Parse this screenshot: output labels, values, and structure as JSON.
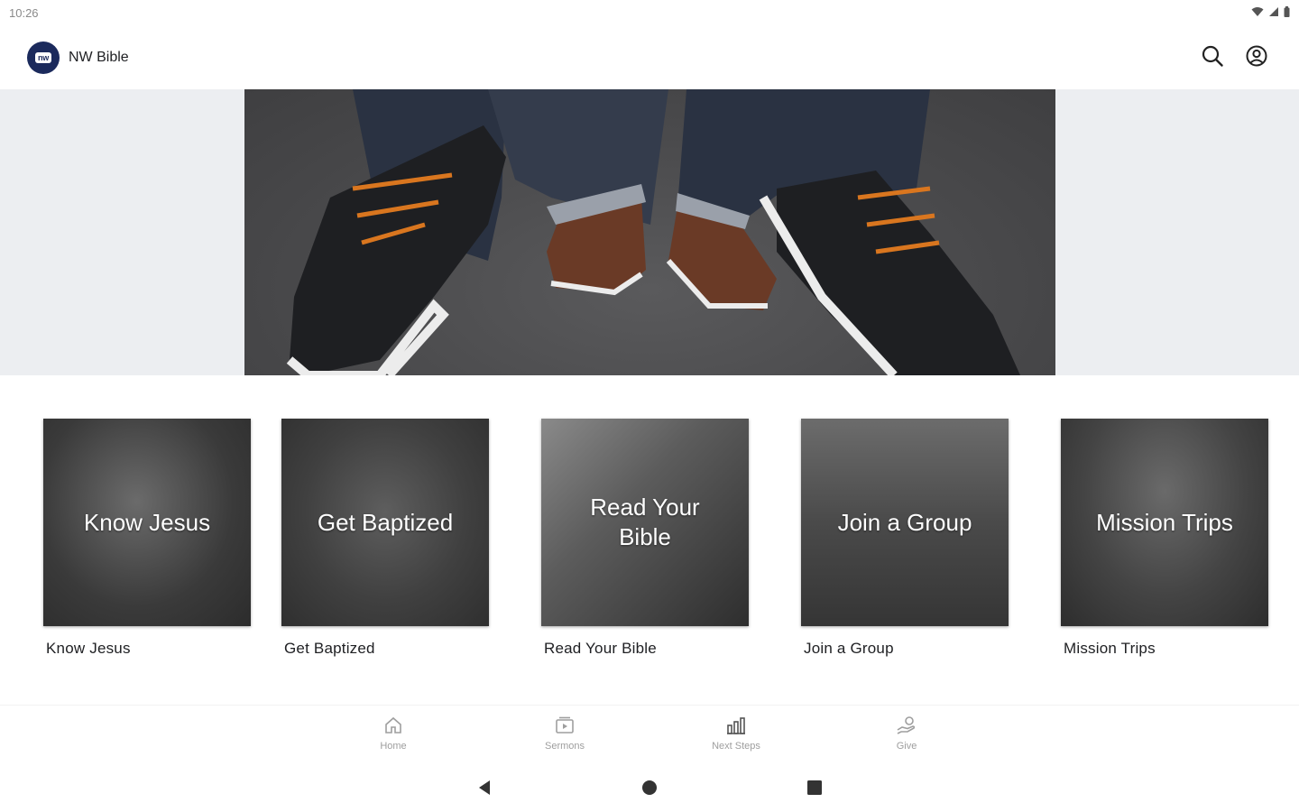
{
  "status_bar": {
    "time": "10:26"
  },
  "app": {
    "title": "NW Bible",
    "logo_text": "nw"
  },
  "header_actions": {
    "search_icon": "search-icon",
    "account_icon": "account-circle-icon"
  },
  "hero": {
    "icon": "hero-image-shoes"
  },
  "cards": [
    {
      "thumb_title": "Know Jesus",
      "caption": "Know Jesus"
    },
    {
      "thumb_title": "Get Baptized",
      "caption": "Get Baptized"
    },
    {
      "thumb_title": "Read Your Bible",
      "caption": "Read Your Bible"
    },
    {
      "thumb_title": "Join a Group",
      "caption": "Join a Group"
    },
    {
      "thumb_title": "Mission Trips",
      "caption": "Mission Trips"
    }
  ],
  "bottom_nav": [
    {
      "label": "Home",
      "icon": "home-icon"
    },
    {
      "label": "Sermons",
      "icon": "sermons-icon"
    },
    {
      "label": "Next Steps",
      "icon": "next-steps-icon"
    },
    {
      "label": "Give",
      "icon": "give-icon"
    }
  ],
  "colors": {
    "brand": "#1b2a5c",
    "hero_band": "#eceef1",
    "nav_label": "#9e9e9e"
  }
}
